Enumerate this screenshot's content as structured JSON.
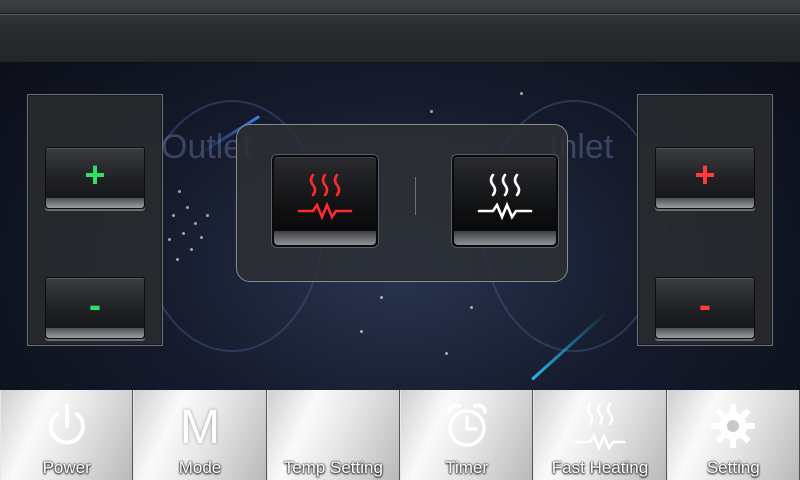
{
  "colors": {
    "green": "#2ee06a",
    "red": "#ff3b3b",
    "white": "#ffffff"
  },
  "outlet": {
    "label": "Outlet",
    "increase_label": "+",
    "decrease_label": "-",
    "color": "#2ee06a"
  },
  "inlet": {
    "label": "Inlet",
    "increase_label": "+",
    "decrease_label": "-",
    "color": "#ff3b3b"
  },
  "heaters": [
    {
      "name": "outlet-heater",
      "icon": "heater-icon",
      "color": "#ff2a2a"
    },
    {
      "name": "inlet-heater",
      "icon": "heater-icon",
      "color": "#ffffff"
    }
  ],
  "nav": {
    "power": {
      "label": "Power",
      "icon": "power-icon"
    },
    "mode": {
      "label": "Mode",
      "glyph": "M",
      "icon": "mode-m-icon"
    },
    "temp_setting": {
      "label": "Temp Setting"
    },
    "timer": {
      "label": "Timer",
      "icon": "alarm-clock-icon"
    },
    "fast_heating": {
      "label": "Fast Heating",
      "icon": "fast-heating-icon"
    },
    "setting": {
      "label": "Setting",
      "icon": "gear-icon"
    }
  }
}
